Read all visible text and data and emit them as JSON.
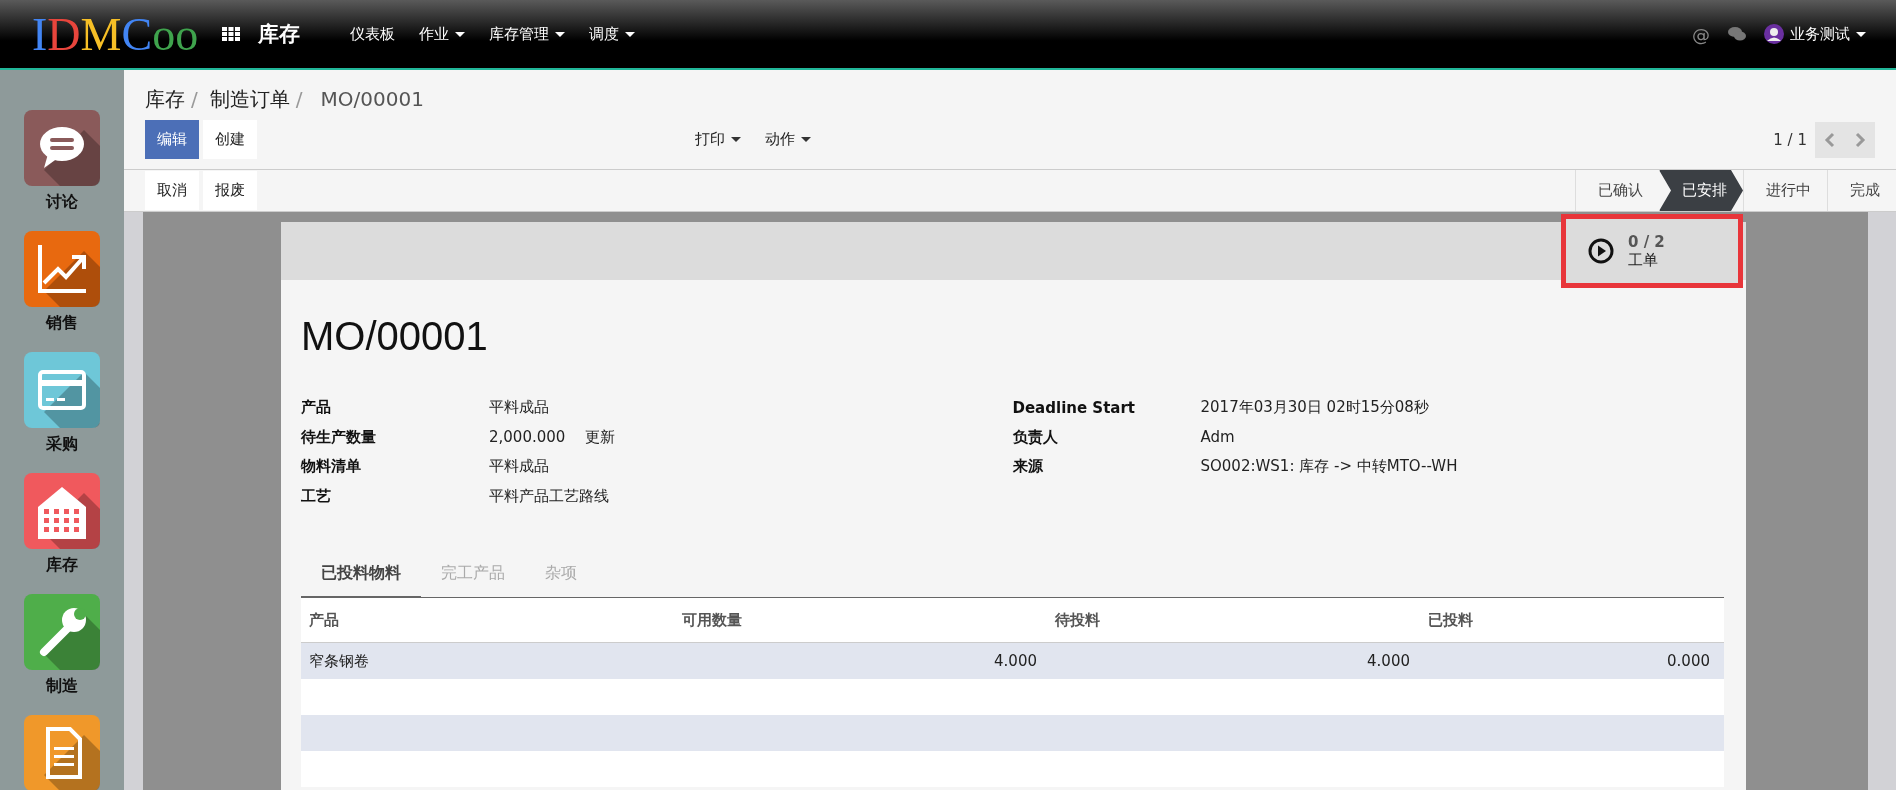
{
  "topbar": {
    "logo": [
      {
        "text": "I",
        "color": "#4285f4"
      },
      {
        "text": "D",
        "color": "#e8453c"
      },
      {
        "text": "M",
        "color": "#f6bf26"
      },
      {
        "text": "C",
        "color": "#4285f4"
      },
      {
        "text": "oo",
        "color": "#3fa34d"
      }
    ],
    "app_name": "库存",
    "menu": [
      {
        "label": "仪表板",
        "has_dropdown": false
      },
      {
        "label": "作业",
        "has_dropdown": true
      },
      {
        "label": "库存管理",
        "has_dropdown": true
      },
      {
        "label": "调度",
        "has_dropdown": true
      }
    ],
    "mention": "@",
    "user": "业务测试"
  },
  "sidebar": {
    "items": [
      {
        "label": "讨论",
        "kind": "chat",
        "color": "#8a5a5a"
      },
      {
        "label": "销售",
        "kind": "chart",
        "color": "#e8690f"
      },
      {
        "label": "采购",
        "kind": "card",
        "color": "#6ec7d8"
      },
      {
        "label": "库存",
        "kind": "building",
        "color": "#f0595d"
      },
      {
        "label": "制造",
        "kind": "wrench",
        "color": "#4fae4a"
      },
      {
        "kind": "document",
        "color": "#f0982a"
      }
    ]
  },
  "breadcrumb": [
    {
      "label": "库存",
      "separator": "/"
    },
    {
      "label": "制造订单",
      "separator": "/"
    }
  ],
  "breadcrumb_current": "MO/00001",
  "buttons": [
    {
      "label": "编辑",
      "primary": true
    },
    {
      "label": "创建",
      "primary": false
    }
  ],
  "dropdowns": [
    "打印",
    "动作"
  ],
  "pager": "1 / 1",
  "status_buttons": [
    "取消",
    "报废"
  ],
  "stages": [
    {
      "label": "已确认",
      "selected": false
    },
    {
      "label": "已安排",
      "selected": true
    },
    {
      "label": "进行中",
      "selected": false
    },
    {
      "label": "完成",
      "selected": false
    }
  ],
  "smart_button": {
    "count": "0 / 2",
    "label": "工单"
  },
  "title": "MO/00001",
  "fields_left": [
    {
      "label": "产品",
      "value": "平料成品"
    },
    {
      "label": "待生产数量",
      "value": "2,000.000",
      "action": "更新"
    },
    {
      "label": "物料清单",
      "value": "平料成品"
    },
    {
      "label": "工艺",
      "value": "平料产品工艺路线"
    }
  ],
  "fields_right": [
    {
      "label": "Deadline Start",
      "value": "2017年03月30日 02时15分08秒"
    },
    {
      "label": "负责人",
      "value": "Adm"
    },
    {
      "label": "来源",
      "value": "SO002:WS1: 库存 -> 中转MTO--WH"
    }
  ],
  "tabs": [
    {
      "label": "已投料物料",
      "selected": true
    },
    {
      "label": "完工产品",
      "selected": false
    },
    {
      "label": "杂项",
      "selected": false
    }
  ],
  "table": {
    "columns": [
      "产品",
      "可用数量",
      "待投料",
      "已投料"
    ],
    "rows": [
      [
        "窄条钢卷",
        "4.000",
        "4.000",
        "0.000"
      ]
    ]
  }
}
